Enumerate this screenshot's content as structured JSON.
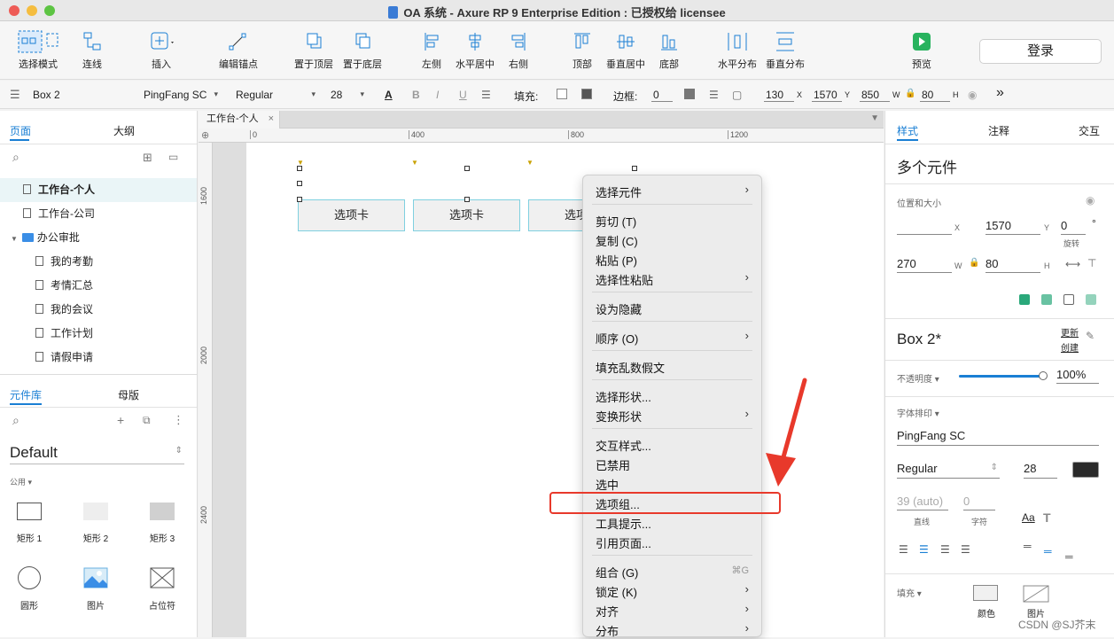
{
  "window": {
    "title": "OA 系统 - Axure RP 9 Enterprise Edition : 已授权给 licensee"
  },
  "toolbar": {
    "items": [
      "选择模式",
      "连线",
      "插入",
      "编辑锚点",
      "置于顶层",
      "置于底层",
      "左侧",
      "水平居中",
      "右侧",
      "顶部",
      "垂直居中",
      "底部",
      "水平分布",
      "垂直分布",
      "预览"
    ],
    "login": "登录"
  },
  "format": {
    "widget_name": "Box 2",
    "font": "PingFang SC",
    "weight": "Regular",
    "size": "28",
    "fill_label": "填充:",
    "border_label": "边框:",
    "border_value": "0",
    "x": "130",
    "x_label": "X",
    "y": "1570",
    "y_label": "Y",
    "w": "850",
    "w_label": "W",
    "h": "80",
    "h_label": "H"
  },
  "left": {
    "tabs": [
      "页面",
      "大纲"
    ],
    "pages": [
      "工作台-个人",
      "工作台-公司",
      "办公审批",
      "我的考勤",
      "考情汇总",
      "我的会议",
      "工作计划",
      "请假申请"
    ],
    "lib_tabs": [
      "元件库",
      "母版"
    ],
    "library": "Default",
    "category": "公用 ▾",
    "widgets": [
      "矩形 1",
      "矩形 2",
      "矩形 3",
      "圆形",
      "图片",
      "占位符"
    ]
  },
  "canvas": {
    "doc_tab": "工作台-个人",
    "ruler_h": [
      "0",
      "400",
      "800",
      "1200"
    ],
    "ruler_v": [
      "1600",
      "2000",
      "2400"
    ],
    "boxes": [
      "选项卡",
      "选项卡",
      "选项卡"
    ]
  },
  "context_menu": {
    "items": [
      "选择元件",
      "剪切 (T)",
      "复制 (C)",
      "粘贴 (P)",
      "选择性粘贴",
      "设为隐藏",
      "顺序 (O)",
      "填充乱数假文",
      "选择形状...",
      "变换形状",
      "交互样式...",
      "已禁用",
      "选中",
      "选项组...",
      "工具提示...",
      "引用页面...",
      "组合 (G)",
      "锁定 (K)",
      "对齐",
      "分布"
    ],
    "shortcut_group": "⌘G",
    "highlighted": "选项组..."
  },
  "right": {
    "tabs": [
      "样式",
      "注释",
      "交互"
    ],
    "heading": "多个元件",
    "pos_size_label": "位置和大小",
    "x_label": "X",
    "y": "1570",
    "y_label": "Y",
    "rotation": "0",
    "rotation_unit": "°",
    "rotation_label": "旋转",
    "w": "270",
    "w_label": "W",
    "h": "80",
    "h_label": "H",
    "style_name": "Box 2*",
    "update": "更新",
    "create": "创建",
    "opacity_label": "不透明度 ▾",
    "opacity": "100%",
    "opacity_level": 1.0,
    "typography_label": "字体排印 ▾",
    "font": "PingFang SC",
    "weight": "Regular",
    "size": "28",
    "line_height": "39 (auto)",
    "letter": "0",
    "line_label": "直线",
    "letter_label": "字符",
    "fill_label": "填充 ▾",
    "fill_color": "颜色",
    "fill_image": "图片"
  },
  "colors": {
    "accent": "#1a7fd4",
    "highlight_box": "#e8392b",
    "arrow": "#e8392b"
  },
  "watermark": "CSDN @SJ芥末"
}
